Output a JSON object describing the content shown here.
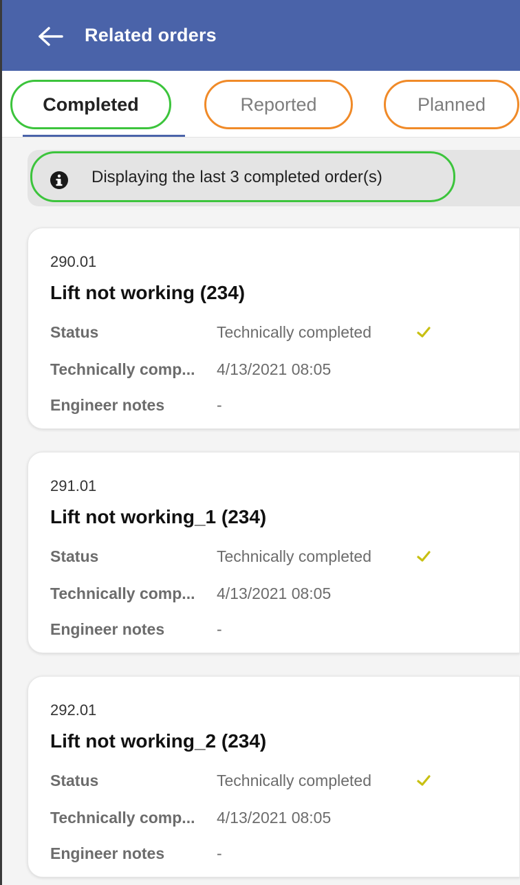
{
  "header": {
    "title": "Related orders",
    "back_icon": "arrow-left-icon",
    "background": "#4a63a9"
  },
  "tabs": [
    {
      "label": "Completed",
      "active": true
    },
    {
      "label": "Reported",
      "active": false
    },
    {
      "label": "Planned",
      "active": false
    }
  ],
  "info_banner": {
    "icon": "info-icon",
    "text": "Displaying the last 3 completed order(s)"
  },
  "orders": [
    {
      "number": "290.01",
      "title": "Lift not working (234)",
      "status_label": "Status",
      "status_value": "Technically completed",
      "status_icon": "check-icon",
      "completed_label": "Technically comp...",
      "completed_value": "4/13/2021 08:05",
      "notes_label": "Engineer notes",
      "notes_value": "-"
    },
    {
      "number": "291.01",
      "title": "Lift not working_1 (234)",
      "status_label": "Status",
      "status_value": "Technically completed",
      "status_icon": "check-icon",
      "completed_label": "Technically comp...",
      "completed_value": "4/13/2021 08:05",
      "notes_label": "Engineer notes",
      "notes_value": "-"
    },
    {
      "number": "292.01",
      "title": "Lift not working_2 (234)",
      "status_label": "Status",
      "status_value": "Technically completed",
      "status_icon": "check-icon",
      "completed_label": "Technically comp...",
      "completed_value": "4/13/2021 08:05",
      "notes_label": "Engineer notes",
      "notes_value": "-"
    }
  ],
  "colors": {
    "accent": "#4a63a9",
    "highlight_green": "#3cc43c",
    "highlight_orange": "#f08a28",
    "check": "#c8c012"
  }
}
